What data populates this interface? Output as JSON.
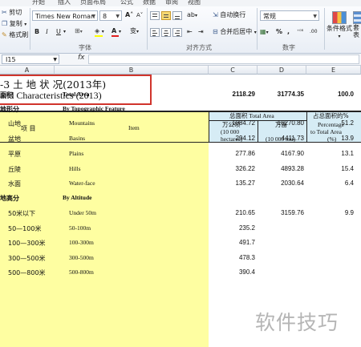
{
  "ribbon": {
    "tabs": [
      "开始",
      "插入",
      "页面布局",
      "公式",
      "数据",
      "审阅",
      "视图"
    ],
    "clipboard": {
      "cut": "剪切",
      "copy": "复制",
      "format_painter": "格式刷"
    },
    "font": {
      "name": "Times New Roman",
      "size": "8",
      "bold": "B",
      "italic": "I",
      "underline": "U",
      "grow": "A˄",
      "shrink": "A˅",
      "font_color_letter": "A",
      "change_case": "变"
    },
    "alignment": {
      "wrap_text": "自动换行",
      "merge_center": "合并后居中"
    },
    "number": {
      "format": "常规",
      "percent": "%",
      "comma": ",",
      "inc_decimal": "⁺⁰⁸",
      "dec_decimal": ".00"
    },
    "styles": {
      "conditional_format": "条件格式",
      "table_format_partial": "套\n表"
    },
    "groups": {
      "font": "字体",
      "alignment": "对齐方式",
      "number": "数字"
    }
  },
  "formula_bar": {
    "name_box": "I15",
    "fx": "fx",
    "value": ""
  },
  "columns": [
    "A",
    "B",
    "C",
    "D",
    "E"
  ],
  "title": {
    "cn": "-3  土 地 状 况(2013年)",
    "en": "and Characteristics (2013)"
  },
  "header": {
    "item_cn": "项   目",
    "item_en": "Item",
    "total_area_group": "总面积   Total Area",
    "c_unit_cn": "万公顷",
    "c_unit_en": "(10 000",
    "c_unit_en2": "hectares)",
    "d_unit_cn": "万亩",
    "d_unit_en": "(10 000 mu)",
    "e_cn": "占总面积的%",
    "e_en1": "Percentage",
    "e_en2": "to Total Area",
    "e_en3": "(%)"
  },
  "rows": [
    {
      "cn": "面积",
      "en": "Total Area",
      "c": "2118.29",
      "d": "31774.35",
      "e": "100.0",
      "bold": true,
      "indent": 0
    },
    {
      "cn": "地形分",
      "en": "By Topographic Feature",
      "c": "",
      "d": "",
      "e": "",
      "bold": true,
      "indent": 0
    },
    {
      "cn": "山地",
      "en": "Mountains",
      "c": "1084.72",
      "d": "16270.80",
      "e": "51.2",
      "bold": false,
      "indent": 1
    },
    {
      "cn": "盆地",
      "en": "Basins",
      "c": "294.12",
      "d": "4411.73",
      "e": "13.9",
      "bold": false,
      "indent": 1
    },
    {
      "cn": "平原",
      "en": "Plains",
      "c": "277.86",
      "d": "4167.90",
      "e": "13.1",
      "bold": false,
      "indent": 1
    },
    {
      "cn": "丘陵",
      "en": "Hills",
      "c": "326.22",
      "d": "4893.28",
      "e": "15.4",
      "bold": false,
      "indent": 1
    },
    {
      "cn": "水面",
      "en": "Water-face",
      "c": "135.27",
      "d": "2030.64",
      "e": "6.4",
      "bold": false,
      "indent": 1
    },
    {
      "cn": "地高分",
      "en": "By Altitude",
      "c": "",
      "d": "",
      "e": "",
      "bold": true,
      "indent": 0
    },
    {
      "cn": "50米以下",
      "en": "Under 50m",
      "c": "210.65",
      "d": "3159.76",
      "e": "9.9",
      "bold": false,
      "indent": 1
    },
    {
      "cn": "50—100米",
      "en": "50-100m",
      "c": "235.2",
      "d": "",
      "e": "",
      "bold": false,
      "indent": 1
    },
    {
      "cn": "100—300米",
      "en": "100-300m",
      "c": "491.7",
      "d": "",
      "e": "",
      "bold": false,
      "indent": 1
    },
    {
      "cn": "300—500米",
      "en": "300-500m",
      "c": "478.3",
      "d": "",
      "e": "",
      "bold": false,
      "indent": 1
    },
    {
      "cn": "500—800米",
      "en": "500-800m",
      "c": "390.4",
      "d": "",
      "e": "",
      "bold": false,
      "indent": 1
    }
  ],
  "watermark": "软件技巧"
}
